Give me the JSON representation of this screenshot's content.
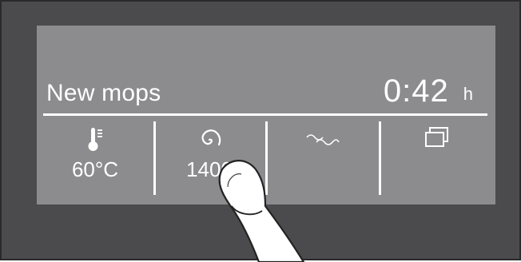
{
  "display": {
    "program_name": "New mops",
    "remaining_time": "0:42",
    "time_unit": "h"
  },
  "options": [
    {
      "icon": "thermometer-icon",
      "value": "60°C"
    },
    {
      "icon": "spin-speed-icon",
      "value": "1400"
    },
    {
      "icon": "rinse-icon",
      "value": ""
    },
    {
      "icon": "extra-options-icon",
      "value": ""
    }
  ],
  "colors": {
    "bezel": "#4b4b4d",
    "screen": "#8c8c8e",
    "text": "#ffffff"
  }
}
